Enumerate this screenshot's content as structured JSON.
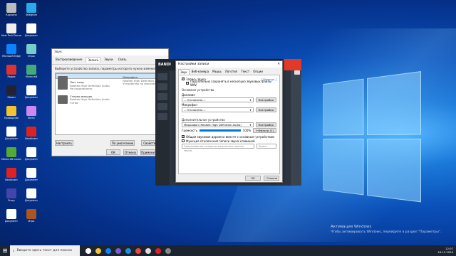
{
  "desktop": {
    "icons": [
      {
        "label": "Корзина"
      },
      {
        "label": "Telegram"
      },
      {
        "label": "New Text Document"
      },
      {
        "label": "Документ"
      },
      {
        "label": "Microsoft Edge"
      },
      {
        "label": "Игры"
      },
      {
        "label": "Радио"
      },
      {
        "label": "Minecraft"
      },
      {
        "label": "Steam"
      },
      {
        "label": "Документ"
      },
      {
        "label": "Проводник"
      },
      {
        "label": "Фото"
      },
      {
        "label": "Документ"
      },
      {
        "label": "Bandicam"
      },
      {
        "label": "Minecraft Launcher"
      },
      {
        "label": "Документ"
      },
      {
        "label": "Bandicam"
      },
      {
        "label": "Документ"
      },
      {
        "label": "Proxy"
      },
      {
        "label": "Документ"
      },
      {
        "label": "Документ"
      },
      {
        "label": "Игра"
      }
    ]
  },
  "sound_window": {
    "title": "Звук",
    "tabs": [
      "Воспроизведение",
      "Запись",
      "Звуки",
      "Связь"
    ],
    "active_tab": "Запись",
    "hint": "Выберите устройство записи, параметры которого нужно изменить:",
    "devices": [
      {
        "name": "Микрофон",
        "driver": "Realtek High Definition Audio",
        "status": "Устройство по умолчанию"
      },
      {
        "name": "Лин. вход",
        "driver": "Realtek High Definition Audio",
        "status": "Не подключено"
      },
      {
        "name": "Стерео микшер",
        "driver": "Realtek High Definition Audio",
        "status": "Готов"
      }
    ],
    "configure_button": "Настроить",
    "default_button": "По умолчанию",
    "properties_button": "Свойства",
    "ok_button": "ОК",
    "cancel_button": "Отмена",
    "apply_button": "Применить"
  },
  "bandicam": {
    "logo": "BANDI",
    "sidebar_label_1": "Главная",
    "sidebar_label_2": "Дом"
  },
  "settings_dialog": {
    "title": "Настройки записи",
    "tabs": [
      "Звук",
      "Веб-камера",
      "Мышь",
      "Логотип",
      "Текст",
      "Опции"
    ],
    "active_tab": "Звук",
    "record_sound_label": "Запись звука",
    "help_link": "[ Помощь ]",
    "parallel_save_label": "Параллельно сохранять в несколько звуковых файлы WAV",
    "main_device_group": "Основное устройство",
    "speaker_label": "Динамик",
    "speaker_value": "-- Отключено --",
    "microphone_label": "Микрофон",
    "microphone_value": "-- Отключено --",
    "settings_button": "Настройки",
    "additional_group": "Дополнительное устройство",
    "additional_value": "Микрофон (Realtek High Definition Audio)",
    "volume_label": "Громкость",
    "volume_percent": "100%",
    "volume_level": 1.0,
    "boost_label": "+Фильтр (1)",
    "mix_label": "Общая звуковая дорожка вместе с основным устройством",
    "hotkey_label": "Функция отключения записи звука клавишей",
    "hotkey_placeholder": "Удерживание клавиши разрешает запись звука",
    "hotkey_key": "Space",
    "ok_button": "OK",
    "cancel_button": "Отмена"
  },
  "taskbar": {
    "search_placeholder": "Введите здесь текст для поиска",
    "time": "12:07",
    "date": "18.12.2020"
  },
  "watermark": {
    "line1": "Активация Windows",
    "line2": "Чтобы активировать Windows, перейдите в раздел \"Параметры\"."
  }
}
